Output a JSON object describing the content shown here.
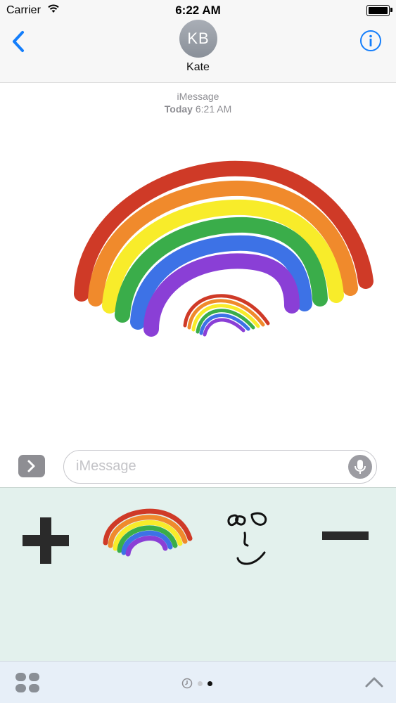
{
  "status_bar": {
    "carrier": "Carrier",
    "time": "6:22 AM",
    "wifi_icon": "wifi-icon",
    "battery_icon": "battery-icon"
  },
  "header": {
    "back_icon": "chevron-left-icon",
    "avatar_initials": "KB",
    "contact_name": "Kate",
    "info_icon": "info-icon"
  },
  "conversation": {
    "service_label": "iMessage",
    "date_day": "Today",
    "date_time": "6:21 AM",
    "message_sticker": "rainbow-drawing"
  },
  "compose": {
    "apps_toggle_icon": "chevron-right-icon",
    "placeholder": "iMessage",
    "value": "",
    "mic_icon": "microphone-icon"
  },
  "sticker_tray": {
    "stickers": [
      "plus-sticker",
      "rainbow-sticker",
      "face-sticker",
      "minus-sticker"
    ]
  },
  "bottom_bar": {
    "app_drawer_icon": "app-drawer-icon",
    "pages": [
      "recents-page",
      "page-2",
      "page-3"
    ],
    "active_page": 3,
    "expand_icon": "chevron-up-icon"
  },
  "colors": {
    "accent": "#147efb",
    "tray_background": "#e3f1ed",
    "rainbow": [
      "#cf3a27",
      "#f08a2c",
      "#f8ec2a",
      "#3aad4a",
      "#3d72e6",
      "#8a3fd6"
    ]
  }
}
